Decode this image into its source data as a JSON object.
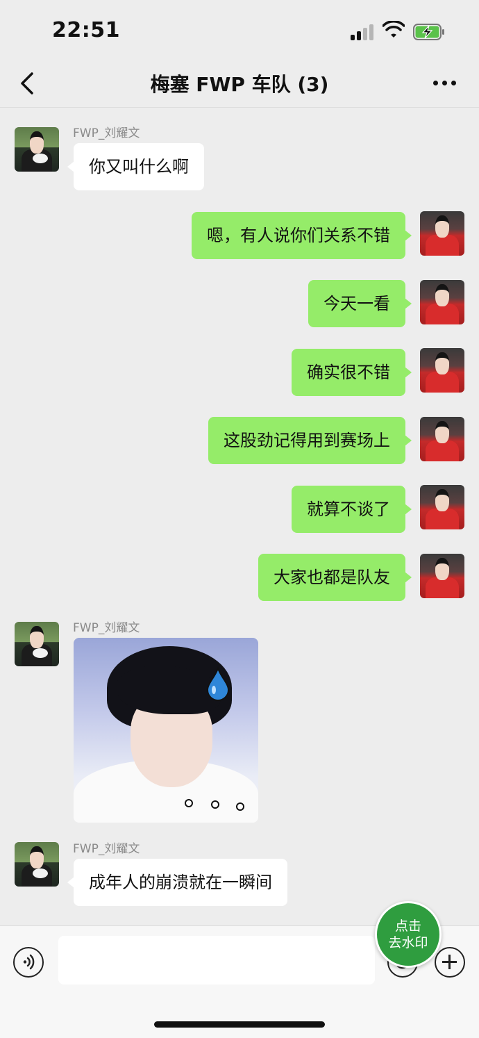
{
  "status_bar": {
    "time": "22:51"
  },
  "nav": {
    "title": "梅塞 FWP 车队 (3)"
  },
  "messages": [
    {
      "sender": "FWP_刘耀文",
      "text": "你又叫什么啊"
    },
    {
      "text": "嗯，有人说你们关系不错"
    },
    {
      "text": "今天一看"
    },
    {
      "text": "确实很不错"
    },
    {
      "text": "这股劲记得用到赛场上"
    },
    {
      "text": "就算不谈了"
    },
    {
      "text": "大家也都是队友"
    },
    {
      "sender": "FWP_刘耀文",
      "type": "sticker"
    },
    {
      "sender": "FWP_刘耀文",
      "text": "成年人的崩溃就在一瞬间"
    }
  ],
  "watermark_button": {
    "line1": "点击",
    "line2": "去水印"
  },
  "icons": {
    "back": "chevron-left-icon",
    "more": "more-dots-icon",
    "voice": "voice-icon",
    "emoji": "emoji-icon",
    "plus": "plus-icon",
    "signal": "cellular-signal-icon",
    "wifi": "wifi-icon",
    "battery": "battery-charging-icon"
  },
  "colors": {
    "background": "#ededed",
    "outgoing_bubble": "#95ec69",
    "incoming_bubble": "#ffffff",
    "watermark_button": "#2f9d3f"
  }
}
